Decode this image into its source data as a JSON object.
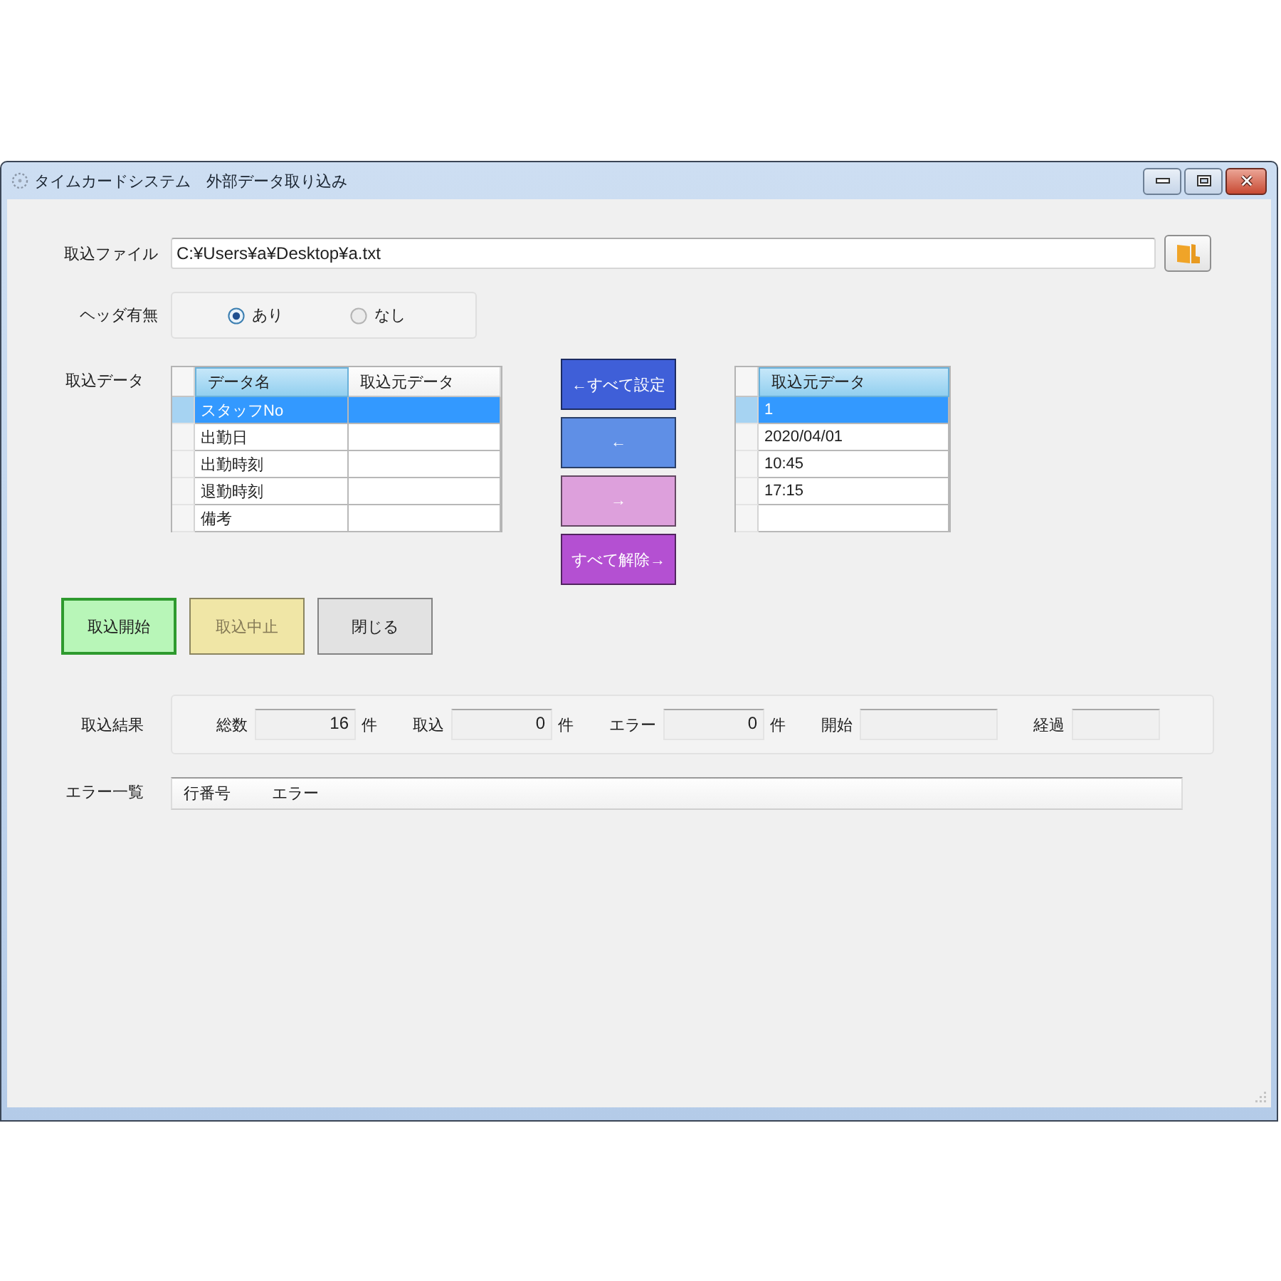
{
  "window": {
    "title": "タイムカードシステム　外部データ取り込み"
  },
  "file": {
    "label": "取込ファイル",
    "value": "C:¥Users¥a¥Desktop¥a.txt"
  },
  "header_option": {
    "label": "ヘッダ有無",
    "options": [
      {
        "label": "あり",
        "selected": true
      },
      {
        "label": "なし",
        "selected": false
      }
    ]
  },
  "import_data": {
    "label": "取込データ",
    "target_grid": {
      "columns": [
        {
          "label": "データ名",
          "selected": true
        },
        {
          "label": "取込元データ",
          "selected": false
        }
      ],
      "rows": [
        {
          "cells": [
            "スタッフNo"
          ],
          "selected": true
        },
        {
          "cells": [
            "出勤日"
          ],
          "selected": false
        },
        {
          "cells": [
            "出勤時刻"
          ],
          "selected": false
        },
        {
          "cells": [
            "退勤時刻"
          ],
          "selected": false
        },
        {
          "cells": [
            "備考"
          ],
          "selected": false
        }
      ]
    },
    "transfer_buttons": [
      {
        "label": "←すべて設定",
        "color": "#3f5fd8"
      },
      {
        "label": "←",
        "color": "#5f8fe6"
      },
      {
        "label": "→",
        "color": "#dda0dc"
      },
      {
        "label": "すべて解除→",
        "color": "#b450d2"
      }
    ],
    "source_grid": {
      "columns": [
        {
          "label": "取込元データ",
          "selected": true
        }
      ],
      "rows": [
        {
          "cells": [
            "1"
          ],
          "selected": true
        },
        {
          "cells": [
            "2020/04/01"
          ],
          "selected": false
        },
        {
          "cells": [
            "10:45"
          ],
          "selected": false
        },
        {
          "cells": [
            "17:15"
          ],
          "selected": false
        },
        {
          "selected": false
        }
      ]
    }
  },
  "action_buttons": [
    {
      "label": "取込開始",
      "color": "#b8f6b8",
      "focused": true,
      "disabled": false
    },
    {
      "label": "取込中止",
      "color": "#f0e6a6",
      "focused": false,
      "disabled": true
    },
    {
      "label": "閉じる",
      "color": "#e2e2e2",
      "focused": false,
      "disabled": false
    }
  ],
  "results": {
    "label": "取込結果",
    "fields": [
      {
        "kind": "count",
        "label": "総数",
        "value": "16",
        "unit": "件"
      },
      {
        "kind": "count",
        "label": "取込",
        "value": "0",
        "unit": "件"
      },
      {
        "kind": "count",
        "label": "エラー",
        "value": "0",
        "unit": "件"
      },
      {
        "kind": "time",
        "label": "開始"
      },
      {
        "kind": "duration",
        "label": "経過"
      }
    ]
  },
  "error_list": {
    "label": "エラー一覧",
    "columns": [
      "行番号",
      "エラー"
    ]
  }
}
